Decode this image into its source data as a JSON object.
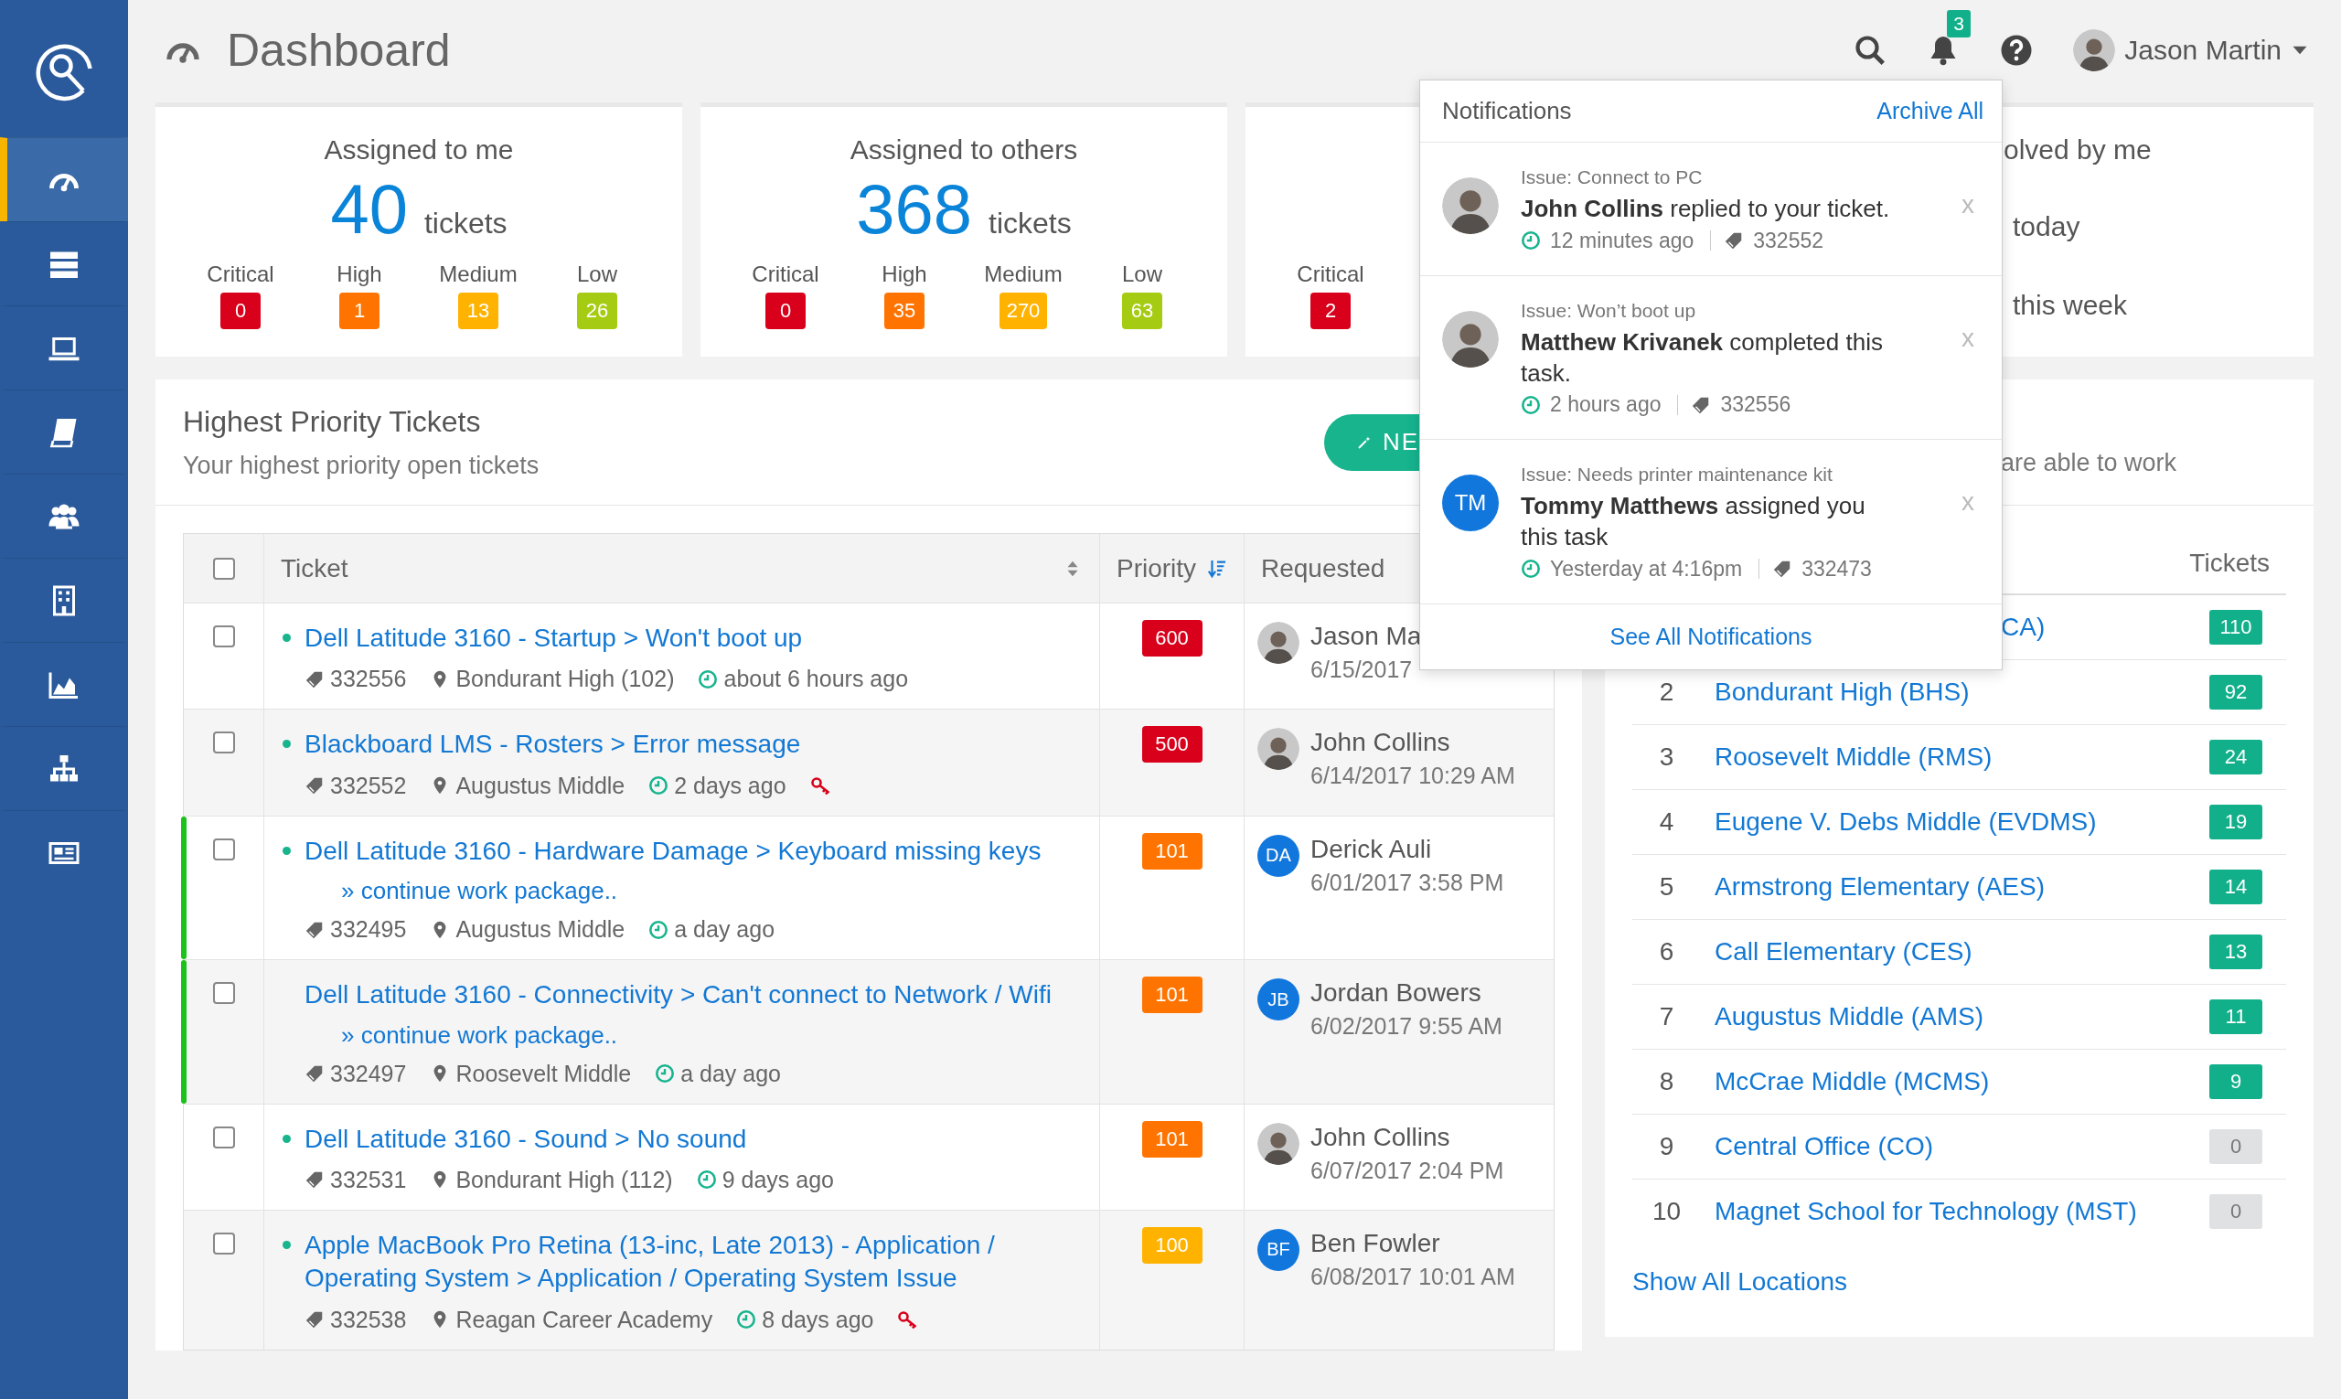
{
  "sidebar": {
    "items": [
      {
        "kind": "gauge",
        "selected": true
      },
      {
        "kind": "servers",
        "selected": false
      },
      {
        "kind": "laptop",
        "selected": false
      },
      {
        "kind": "book",
        "selected": false
      },
      {
        "kind": "users",
        "selected": false
      },
      {
        "kind": "building",
        "selected": false
      },
      {
        "kind": "chart",
        "selected": false
      },
      {
        "kind": "sitemap",
        "selected": false
      },
      {
        "kind": "newspaper",
        "selected": false
      }
    ]
  },
  "header": {
    "title": "Dashboard",
    "notification_count": "3",
    "user_name": "Jason Martin"
  },
  "stat_cards": [
    {
      "kind": "breakdown",
      "title": "Assigned to me",
      "count": "40",
      "unit": "tickets",
      "levels": [
        {
          "label": "Critical",
          "value": "0",
          "color": "#d8001a"
        },
        {
          "label": "High",
          "value": "1",
          "color": "#ff7400"
        },
        {
          "label": "Medium",
          "value": "13",
          "color": "#ffb300"
        },
        {
          "label": "Low",
          "value": "26",
          "color": "#a5cc12"
        }
      ]
    },
    {
      "kind": "breakdown",
      "title": "Assigned to others",
      "count": "368",
      "unit": "tickets",
      "levels": [
        {
          "label": "Critical",
          "value": "0",
          "color": "#d8001a"
        },
        {
          "label": "High",
          "value": "35",
          "color": "#ff7400"
        },
        {
          "label": "Medium",
          "value": "270",
          "color": "#ffb300"
        },
        {
          "label": "Low",
          "value": "63",
          "color": "#a5cc12"
        }
      ]
    },
    {
      "kind": "breakdown",
      "levels": [
        {
          "label": "Critical",
          "value": "2",
          "color": "#d8001a"
        }
      ]
    },
    {
      "kind": "summary",
      "title": "olved by me",
      "lines": [
        "today",
        "this week"
      ]
    }
  ],
  "tickets": {
    "title": "Highest Priority Tickets",
    "subtitle": "Your highest priority open tickets",
    "new_button": "NE",
    "select_all": {
      "checked": false
    },
    "columns": [
      {
        "label": "Ticket",
        "sorted": false
      },
      {
        "label": "Priority",
        "sorted": true
      },
      {
        "label": "Requested"
      }
    ],
    "rows": [
      {
        "checked": false,
        "dot": true,
        "highlighted": false,
        "title": "Dell Latitude 3160 - Startup > Won't boot up",
        "ticket": "332556",
        "location": "Bondurant High (102)",
        "age": "about 6 hours ago",
        "key": false,
        "priority": {
          "value": "600",
          "color": "#d8001a"
        },
        "requester": {
          "avatar": {
            "kind": "photo"
          },
          "name": "Jason Ma",
          "date": "6/15/2017"
        }
      },
      {
        "checked": false,
        "dot": true,
        "highlighted": false,
        "title": "Blackboard LMS - Rosters > Error message",
        "ticket": "332552",
        "location": "Augustus Middle",
        "age": "2 days ago",
        "key": true,
        "priority": {
          "value": "500",
          "color": "#d8001a"
        },
        "requester": {
          "avatar": {
            "kind": "photo"
          },
          "name": "John Collins",
          "date": "6/14/2017 10:29 AM"
        }
      },
      {
        "checked": false,
        "dot": true,
        "highlighted": true,
        "title": "Dell Latitude 3160 - Hardware Damage > Keyboard missing keys",
        "continue": "» continue work package..",
        "ticket": "332495",
        "location": "Augustus Middle",
        "age": "a day ago",
        "key": false,
        "priority": {
          "value": "101",
          "color": "#ff7400"
        },
        "requester": {
          "avatar": {
            "kind": "initials",
            "initials": "DA"
          },
          "name": "Derick Auli",
          "date": "6/01/2017 3:58 PM"
        }
      },
      {
        "checked": false,
        "dot": false,
        "highlighted": true,
        "title": "Dell Latitude 3160 - Connectivity > Can't connect to Network / Wifi",
        "continue": "» continue work package..",
        "ticket": "332497",
        "location": "Roosevelt Middle",
        "age": "a day ago",
        "key": false,
        "priority": {
          "value": "101",
          "color": "#ff7400"
        },
        "requester": {
          "avatar": {
            "kind": "initials",
            "initials": "JB"
          },
          "name": "Jordan Bowers",
          "date": "6/02/2017 9:55 AM"
        }
      },
      {
        "checked": false,
        "dot": true,
        "highlighted": false,
        "title": "Dell Latitude 3160 - Sound > No sound",
        "ticket": "332531",
        "location": "Bondurant High (112)",
        "age": "9 days ago",
        "key": false,
        "priority": {
          "value": "101",
          "color": "#ff7400"
        },
        "requester": {
          "avatar": {
            "kind": "photo"
          },
          "name": "John Collins",
          "date": "6/07/2017 2:04 PM"
        }
      },
      {
        "checked": false,
        "dot": true,
        "highlighted": false,
        "title": "Apple MacBook Pro Retina (13-inc, Late 2013) - Application / Operating System > Application / Operating System Issue",
        "ticket": "332538",
        "location": "Reagan Career Academy",
        "age": "8 days ago",
        "key": true,
        "priority": {
          "value": "100",
          "color": "#ffb300"
        },
        "requester": {
          "avatar": {
            "kind": "initials",
            "initials": "BF"
          },
          "name": "Ben Fowler",
          "date": "6/08/2017 10:01 AM"
        }
      }
    ]
  },
  "locations": {
    "subtitle": "are able to work",
    "column": "Tickets",
    "rows": [
      {
        "name": "CA)",
        "count": "110",
        "color": "#12b08a"
      },
      {
        "rank": "2",
        "name": "Bondurant High (BHS)",
        "count": "92",
        "color": "#12b08a"
      },
      {
        "rank": "3",
        "name": "Roosevelt Middle (RMS)",
        "count": "24",
        "color": "#12b08a"
      },
      {
        "rank": "4",
        "name": "Eugene V. Debs Middle (EVDMS)",
        "count": "19",
        "color": "#12b08a"
      },
      {
        "rank": "5",
        "name": "Armstrong Elementary (AES)",
        "count": "14",
        "color": "#12b08a"
      },
      {
        "rank": "6",
        "name": "Call Elementary (CES)",
        "count": "13",
        "color": "#12b08a"
      },
      {
        "rank": "7",
        "name": "Augustus Middle (AMS)",
        "count": "11",
        "color": "#12b08a"
      },
      {
        "rank": "8",
        "name": "McCrae Middle (MCMS)",
        "count": "9",
        "color": "#12b08a"
      },
      {
        "rank": "9",
        "name": "Central Office (CO)",
        "count": "0",
        "color": "#dfe1e3"
      },
      {
        "rank": "10",
        "name": "Magnet School for Technology (MST)",
        "count": "0",
        "color": "#dfe1e3"
      }
    ],
    "footer_link": "Show All Locations"
  },
  "notifications": {
    "title": "Notifications",
    "action": "Archive All",
    "items": [
      {
        "avatar": {
          "kind": "photo"
        },
        "issue": "Issue: Connect to PC",
        "message": "**John Collins** replied to your ticket.",
        "time": "12 minutes ago",
        "ticket": "332552",
        "close": "x"
      },
      {
        "avatar": {
          "kind": "photo"
        },
        "issue": "Issue: Won’t boot up",
        "message": "**Matthew Krivanek** completed this task.",
        "time": "2 hours ago",
        "ticket": "332556",
        "close": "x"
      },
      {
        "avatar": {
          "kind": "initials",
          "initials": "TM"
        },
        "issue": "Issue: Needs printer maintenance kit",
        "message": "**Tommy Matthews** assigned you this task",
        "time": "Yesterday at 4:16pm",
        "ticket": "332473",
        "close": "x"
      }
    ],
    "footer": "See All Notifications"
  }
}
